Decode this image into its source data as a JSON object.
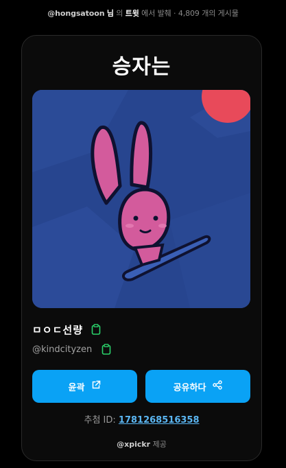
{
  "header": {
    "handle": "@hongsatoon",
    "suffix_nim": "님",
    "particle": "의",
    "source": "트윗",
    "rest": "에서 발췌 · 4,809 개의 게시물"
  },
  "card": {
    "title": "승자는",
    "image_description": "",
    "display_name": "ㅁㅇㄷ선량",
    "username": "@kindcityzen",
    "buttons": {
      "left_label": "윤곽",
      "right_label": "공유하다"
    },
    "recommend_label": "추첨 ID:",
    "recommend_id": "1781268516358",
    "footer_brand": "@xpickr",
    "footer_suffix": "제공"
  },
  "colors": {
    "accent": "#0aa2f5",
    "clipboard_green": "#2bd36b",
    "link": "#5bb6f2"
  },
  "icons": {
    "copy_name": "clipboard-icon",
    "copy_handle": "clipboard-icon",
    "left_button": "external-link-icon",
    "right_button": "share-icon"
  }
}
